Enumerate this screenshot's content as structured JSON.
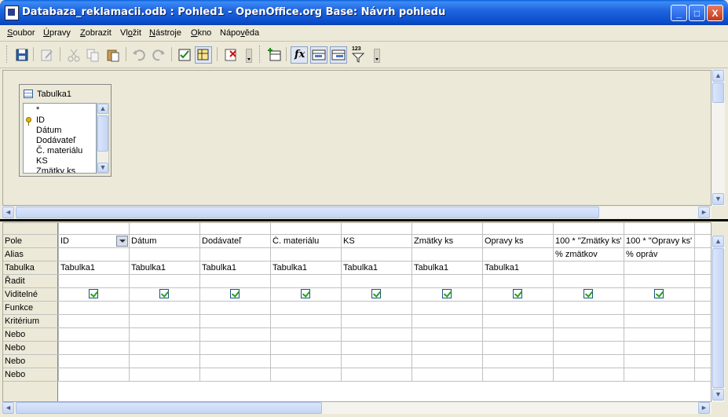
{
  "window": {
    "title": "Databaza_reklamacii.odb : Pohled1 - OpenOffice.org Base: Návrh pohledu",
    "controls": {
      "minimize": "_",
      "maximize": "□",
      "close": "X"
    }
  },
  "menu": {
    "items": [
      {
        "accel": "S",
        "rest": "oubor"
      },
      {
        "accel": "Ú",
        "rest": "pravy"
      },
      {
        "accel": "Z",
        "rest": "obrazit"
      },
      {
        "pre": "Vl",
        "accel": "o",
        "rest": "žit"
      },
      {
        "accel": "N",
        "rest": "ástroje"
      },
      {
        "accel": "O",
        "rest": "kno"
      },
      {
        "pre": "Nápo",
        "accel": "v",
        "rest": "ěda"
      }
    ]
  },
  "toolbar": {
    "icons": [
      "save-icon",
      "edit-icon",
      "cut-icon",
      "copy-icon",
      "paste-icon",
      "undo-icon",
      "redo-icon",
      "design-view-icon",
      "add-table-icon",
      "delete-icon",
      "add-tables-icon",
      "functions-icon",
      "table-name-icon",
      "alias-icon",
      "distinct-values-icon"
    ],
    "functions_glyph": "fx",
    "distinct_glyph": "123",
    "accent": "#0a5fd8"
  },
  "table_window": {
    "title": "Tabulka1",
    "fields": [
      "*",
      "ID",
      "Dátum",
      "Dodávateľ",
      "Č. materiálu",
      "KS",
      "Zmätky ks"
    ]
  },
  "grid": {
    "row_headers": [
      "Pole",
      "Alias",
      "Tabulka",
      "Řadit",
      "Viditelné",
      "Funkce",
      "Kritérium",
      "Nebo",
      "Nebo",
      "Nebo",
      "Nebo"
    ],
    "columns": [
      {
        "field": "ID",
        "alias": "",
        "table": "Tabulka1",
        "visible": true
      },
      {
        "field": "Dátum",
        "alias": "",
        "table": "Tabulka1",
        "visible": true
      },
      {
        "field": "Dodávateľ",
        "alias": "",
        "table": "Tabulka1",
        "visible": true
      },
      {
        "field": "Č. materiálu",
        "alias": "",
        "table": "Tabulka1",
        "visible": true
      },
      {
        "field": "KS",
        "alias": "",
        "table": "Tabulka1",
        "visible": true
      },
      {
        "field": "Zmätky ks",
        "alias": "",
        "table": "Tabulka1",
        "visible": true
      },
      {
        "field": "Opravy ks",
        "alias": "",
        "table": "Tabulka1",
        "visible": true
      },
      {
        "field": "100 * \"Zmätky ks\"",
        "alias": "% zmätkov",
        "table": "",
        "visible": true
      },
      {
        "field": "100 * \"Opravy ks\"",
        "alias": "% opráv",
        "table": "",
        "visible": true
      }
    ]
  },
  "scroll": {
    "up": "▲",
    "down": "▼",
    "left": "◄",
    "right": "►"
  }
}
